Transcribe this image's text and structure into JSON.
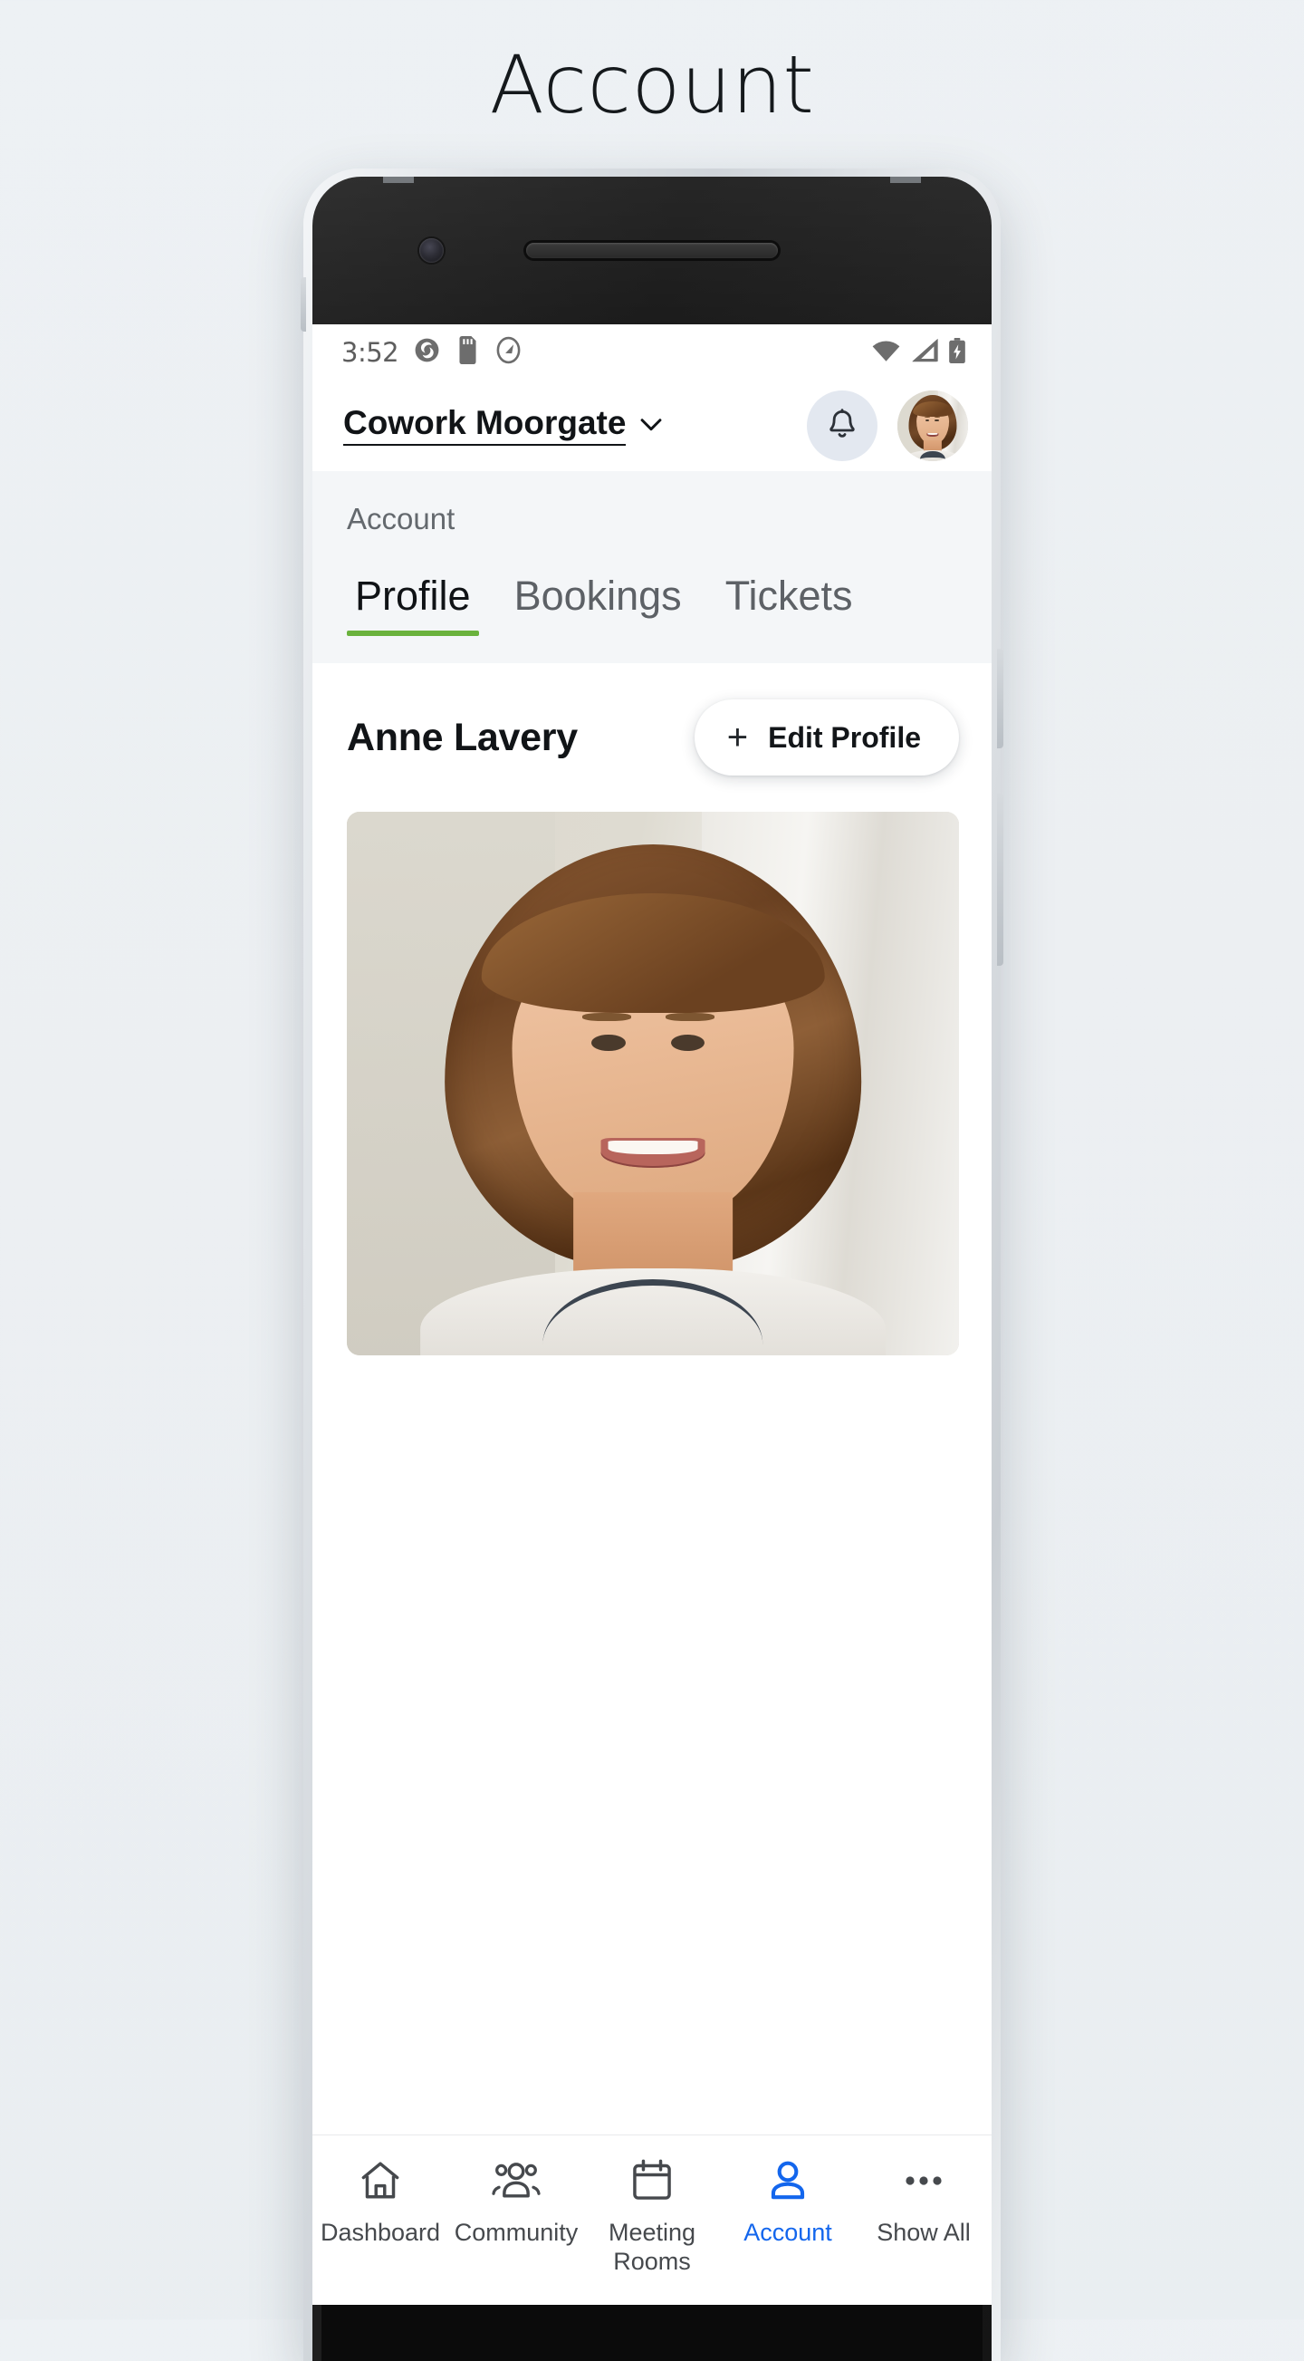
{
  "page": {
    "title": "Account"
  },
  "status_bar": {
    "time": "3:52",
    "left_icons": [
      "app-icon-swirl",
      "sd-card-icon",
      "app-icon-circle-arrow"
    ],
    "right_icons": [
      "wifi-icon",
      "cellular-signal-icon",
      "battery-charging-icon"
    ]
  },
  "app_header": {
    "venue_name": "Cowork Moorgate",
    "venue_chevron": "chevron-down-icon",
    "notifications_icon": "bell-icon",
    "avatar": "user-avatar"
  },
  "section": {
    "label": "Account",
    "tabs": [
      {
        "label": "Profile",
        "active": true
      },
      {
        "label": "Bookings",
        "active": false
      },
      {
        "label": "Tickets",
        "active": false
      }
    ],
    "active_tab_color": "#6ab23d"
  },
  "profile": {
    "name": "Anne Lavery",
    "edit_button": {
      "label": "Edit Profile",
      "icon": "plus-icon"
    },
    "photo_alt": "Profile photo of Anne Lavery"
  },
  "bottom_nav": {
    "active_color": "#1366ed",
    "items": [
      {
        "label": "Dashboard",
        "icon": "home-icon",
        "active": false
      },
      {
        "label": "Community",
        "icon": "people-icon",
        "active": false
      },
      {
        "label": "Meeting Rooms",
        "icon": "calendar-icon",
        "active": false
      },
      {
        "label": "Account",
        "icon": "person-icon",
        "active": true
      },
      {
        "label": "Show All",
        "icon": "ellipsis-icon",
        "active": false
      }
    ]
  }
}
